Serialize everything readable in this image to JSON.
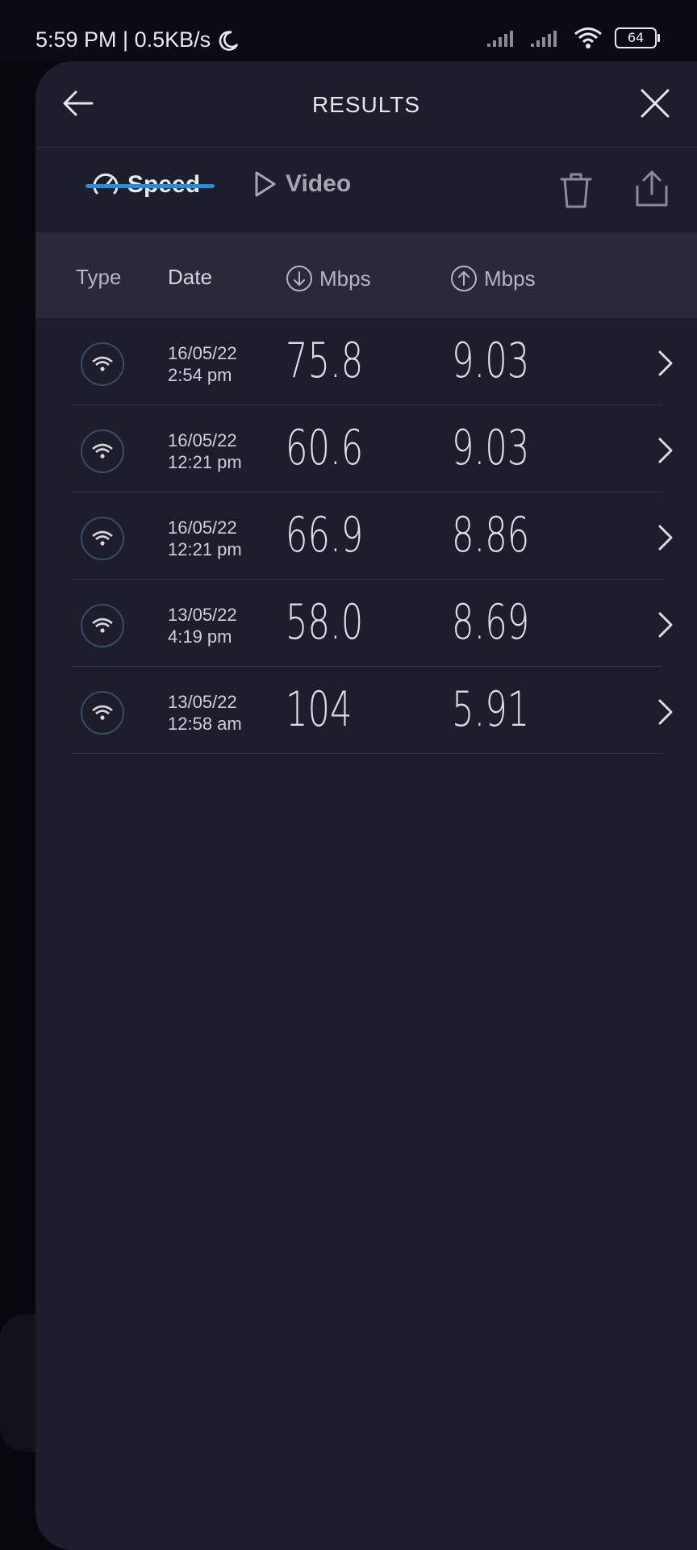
{
  "status_bar": {
    "time_speed": "5:59 PM | 0.5KB/s",
    "battery": "64"
  },
  "header": {
    "title": "RESULTS"
  },
  "tabs": [
    {
      "label": "Speed",
      "active": true
    },
    {
      "label": "Video",
      "active": false
    }
  ],
  "table": {
    "headers": {
      "type": "Type",
      "date": "Date",
      "download": "Mbps",
      "upload": "Mbps"
    },
    "rows": [
      {
        "date": "16/05/22",
        "time": "2:54 pm",
        "download": "75.8",
        "upload": "9.03"
      },
      {
        "date": "16/05/22",
        "time": "12:21 pm",
        "download": "60.6",
        "upload": "9.03"
      },
      {
        "date": "16/05/22",
        "time": "12:21 pm",
        "download": "66.9",
        "upload": "8.86"
      },
      {
        "date": "13/05/22",
        "time": "4:19 pm",
        "download": "58.0",
        "upload": "8.69"
      },
      {
        "date": "13/05/22",
        "time": "12:58 am",
        "download": "104",
        "upload": "5.91"
      }
    ]
  },
  "colors": {
    "accent": "#2d8bd1",
    "background": "#1e1d2c",
    "header_row": "#2a2939"
  }
}
